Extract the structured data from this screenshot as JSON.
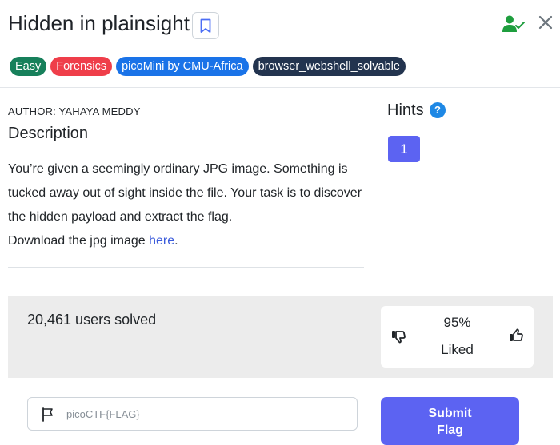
{
  "header": {
    "title": "Hidden in plainsight"
  },
  "tags": [
    {
      "label": "Easy",
      "color": "#17805b"
    },
    {
      "label": "Forensics",
      "color": "#ef3e4a"
    },
    {
      "label": "picoMini by CMU-Africa",
      "color": "#1a73e8"
    },
    {
      "label": "browser_webshell_solvable",
      "color": "#23344f"
    }
  ],
  "author": "AUTHOR: YAHAYA MEDDY",
  "description": {
    "title": "Description",
    "text": "You’re given a seemingly ordinary JPG image. Something is tucked away out of sight inside the file. Your task is to discover the hidden payload and extract the flag.",
    "download_prefix": "Download the jpg image ",
    "download_link": "here",
    "download_suffix": "."
  },
  "hints": {
    "title": "Hints",
    "help_glyph": "?",
    "items": [
      "1"
    ]
  },
  "stats": {
    "solved": "20,461 users solved",
    "liked_percent": "95%",
    "liked_label": "Liked"
  },
  "flag": {
    "placeholder": "picoCTF{FLAG}",
    "value": ""
  },
  "submit": {
    "line1": "Submit",
    "line2": "Flag"
  },
  "colors": {
    "accent": "#5c63f2",
    "solved_icon": "#1e9e3e",
    "hint_help": "#1e88e5"
  },
  "icons": [
    "bookmark-icon",
    "user-check-icon",
    "close-icon",
    "help-icon",
    "thumbs-down-icon",
    "thumbs-up-icon",
    "flag-icon"
  ]
}
